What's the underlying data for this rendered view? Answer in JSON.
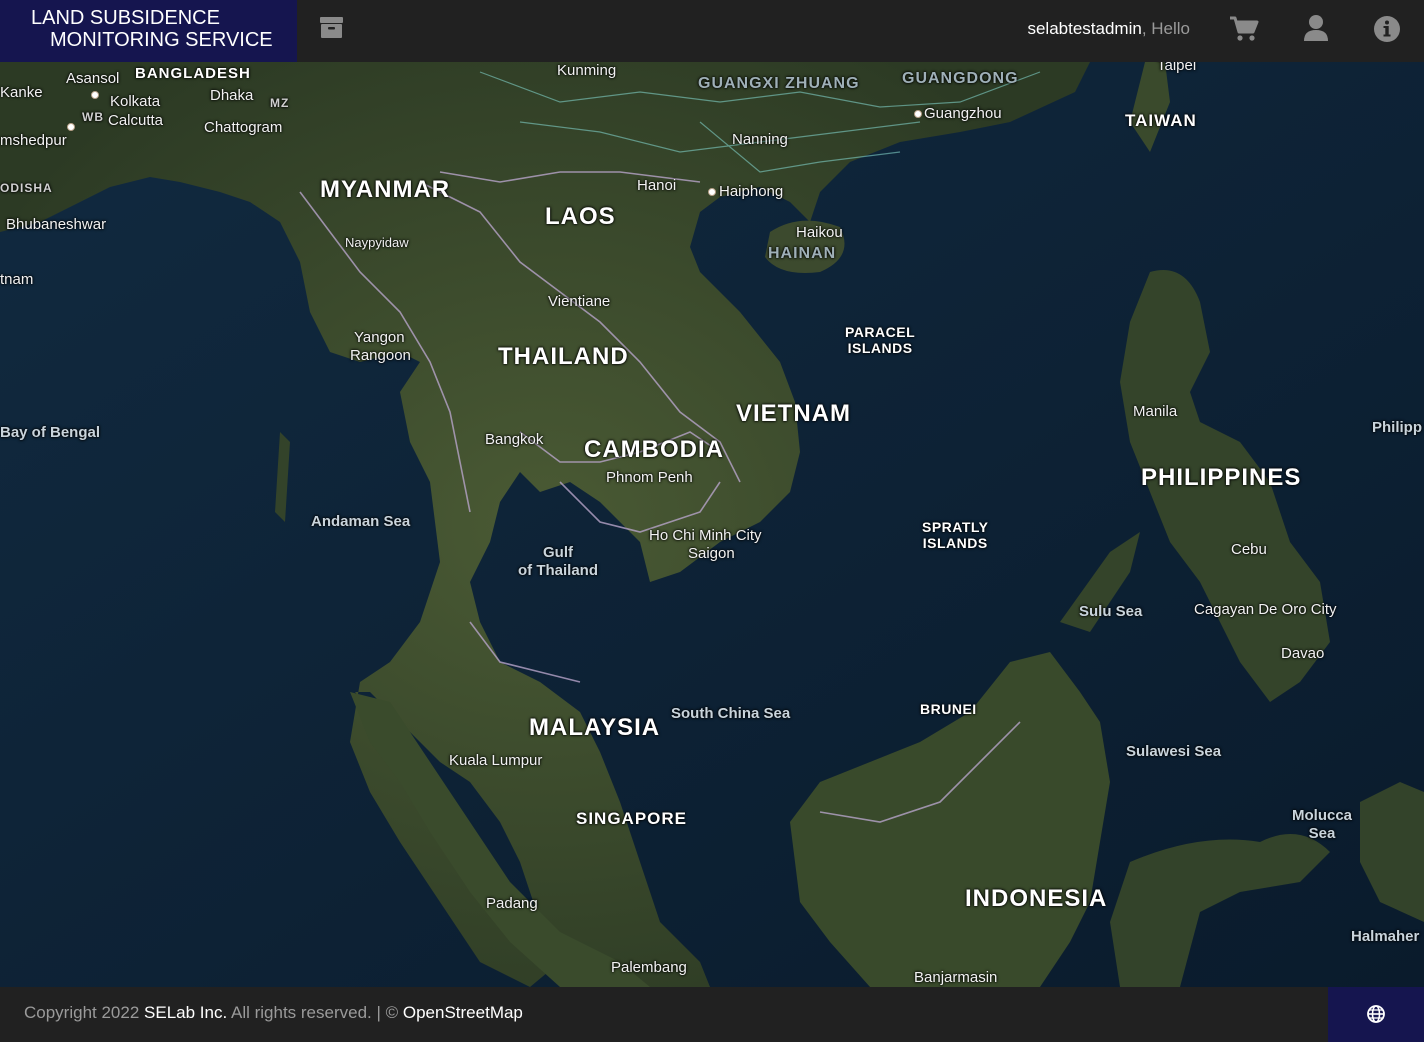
{
  "header": {
    "brand_line1": "LAND SUBSIDENCE",
    "brand_line2": "MONITORING SERVICE",
    "username": "selabtestadmin",
    "greeting": ", Hello",
    "icons": [
      "archive-icon",
      "cart-icon",
      "user-icon",
      "info-icon"
    ]
  },
  "map": {
    "countries": {
      "myanmar": "MYANMAR",
      "laos": "LAOS",
      "thailand": "THAILAND",
      "vietnam": "VIETNAM",
      "cambodia": "CAMBODIA",
      "malaysia": "MALAYSIA",
      "singapore": "SINGAPORE",
      "indonesia": "INDONESIA",
      "philippines": "PHILIPPINES",
      "taiwan": "TAIWAN",
      "bangladesh": "BANGLADESH",
      "brunei": "BRUNEI"
    },
    "islands": {
      "paracel": "PARACEL\nISLANDS",
      "spratly": "SPRATLY\nISLANDS"
    },
    "regions": {
      "guangxi": "GUANGXI ZHUANG",
      "guangdong": "GUANGDONG",
      "hainan": "HAINAN",
      "odisha": "ODISHA",
      "mz": "MZ",
      "wb": "WB"
    },
    "cities": {
      "asansol": "Asansol",
      "kanke": "Kanke",
      "kolkata": "Kolkata",
      "calcutta": "Calcutta",
      "dhaka": "Dhaka",
      "chattogram": "Chattogram",
      "jamshedpur": "mshedpur",
      "bhubaneshwar": "Bhubaneshwar",
      "tnam": "tnam",
      "kunming": "Kunming",
      "nanning": "Nanning",
      "guangzhou": "Guangzhou",
      "taipei": "Taipei",
      "hanoi": "Hanoi",
      "haiphong": "Haiphong",
      "haikou": "Haikou",
      "naypyidaw": "Naypyidaw",
      "vientiane": "Vientiane",
      "yangon": "Yangon",
      "rangoon": "Rangoon",
      "bangkok": "Bangkok",
      "phnom_penh": "Phnom Penh",
      "hcmc": "Ho Chi Minh City",
      "saigon": "Saigon",
      "manila": "Manila",
      "cebu": "Cebu",
      "cagayan": "Cagayan De Oro City",
      "davao": "Davao",
      "kuala_lumpur": "Kuala Lumpur",
      "padang": "Padang",
      "palembang": "Palembang",
      "banjarmasin": "Banjarmasin",
      "halmahera": "Halmaher",
      "philipp": "Philipp"
    },
    "seas": {
      "bay_of_bengal": "Bay of Bengal",
      "andaman": "Andaman Sea",
      "gulf_thailand": "Gulf\nof Thailand",
      "south_china": "South China Sea",
      "sulu": "Sulu Sea",
      "sulawesi": "Sulawesi Sea",
      "molucca": "Molucca\nSea"
    }
  },
  "footer": {
    "copyright_prefix": "Copyright 2022 ",
    "company": "SELab Inc.",
    "rights": " All rights reserved. | © ",
    "osm": "OpenStreetMap",
    "globe_icon": "globe-icon"
  },
  "colors": {
    "brand_bg": "#15154f",
    "bar_bg": "#212121",
    "sea": "#0d2136",
    "land": "#3a4a2c"
  }
}
